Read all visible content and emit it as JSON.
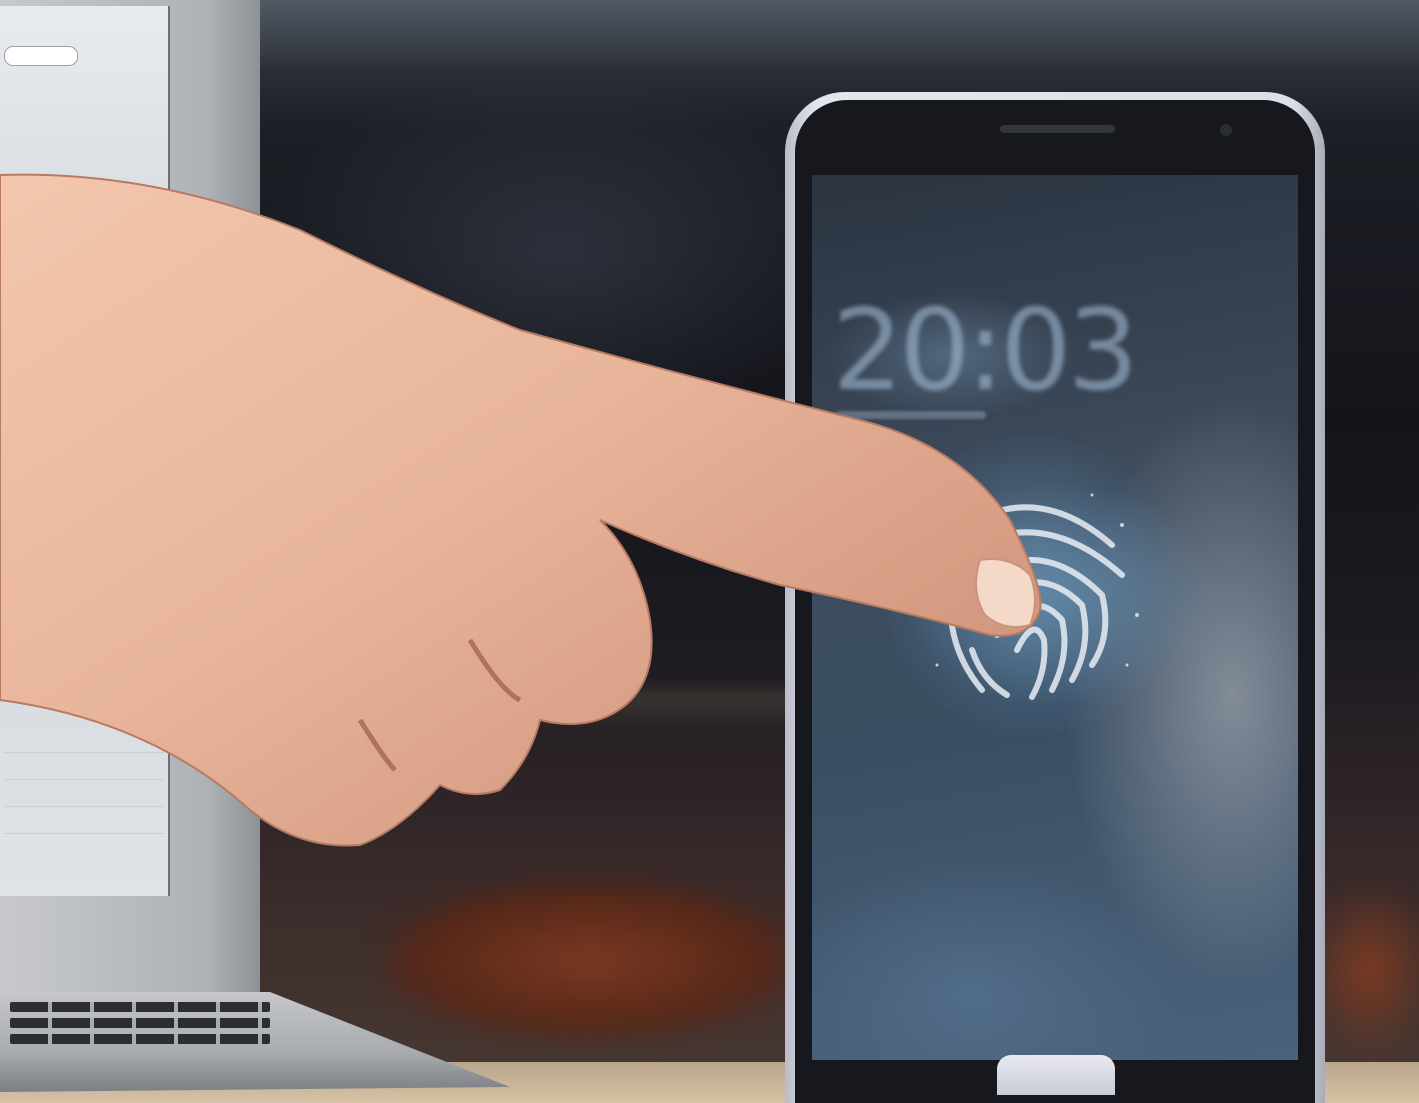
{
  "photo": {
    "subject": "hand-touching-phone-fingerprint",
    "lock_screen": {
      "time": "20:03"
    },
    "colors": {
      "skin": "#e8b59a",
      "phone_frame": "#dcdee8",
      "screen_glow": "#8fb9da",
      "fingerprint": "#e8eef5"
    }
  }
}
